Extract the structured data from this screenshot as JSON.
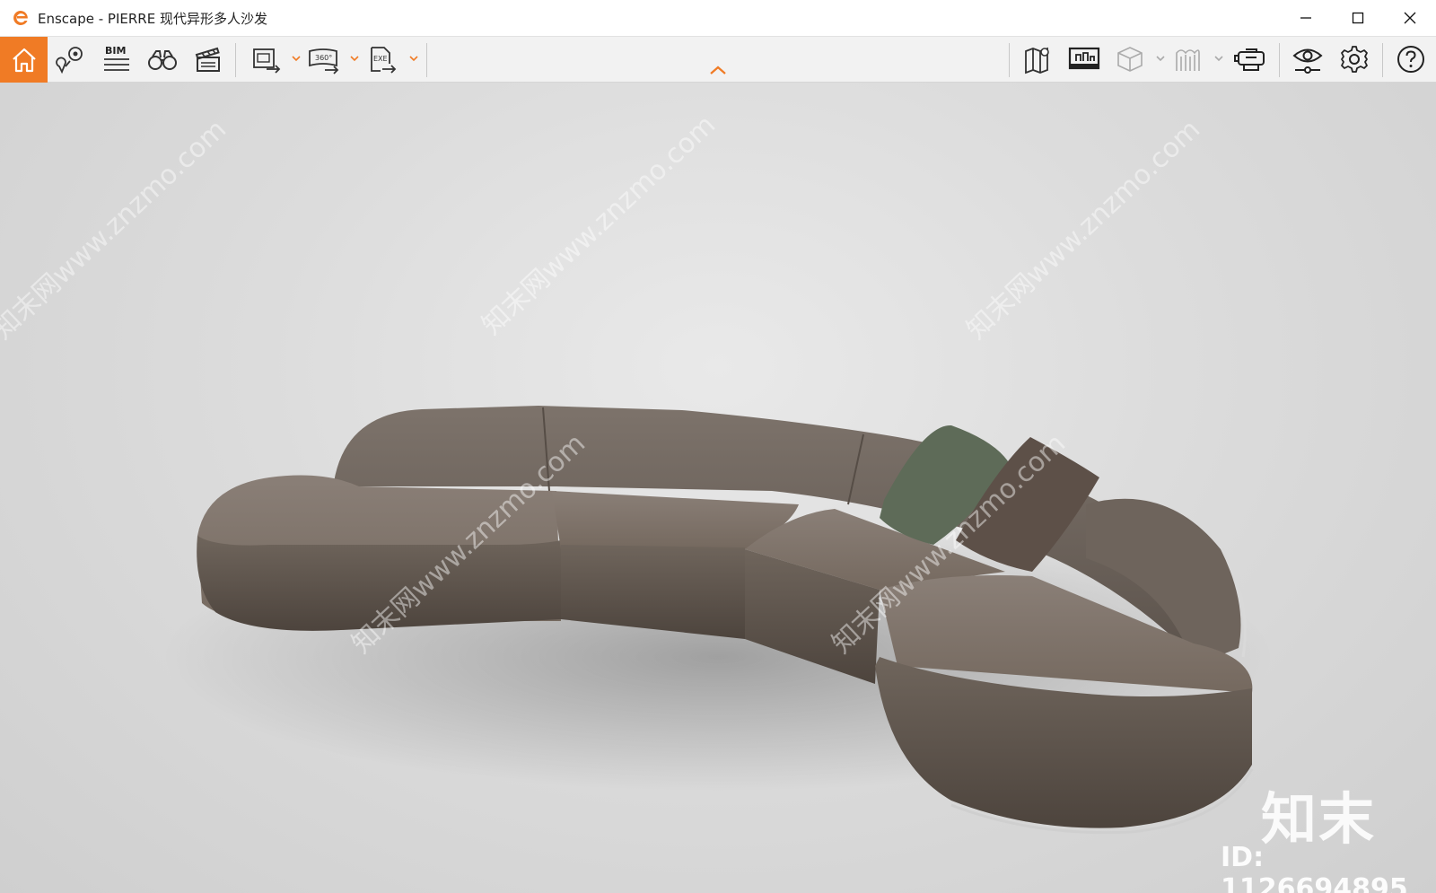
{
  "window": {
    "title": "Enscape - PIERRE 现代异形多人沙发",
    "app_icon": "enscape-logo-icon",
    "controls": [
      "minimize-icon",
      "maximize-icon",
      "close-icon"
    ]
  },
  "toolbar": {
    "accent": "#f07b25",
    "left_buttons": [
      {
        "name": "home-button",
        "icon": "home-icon"
      },
      {
        "name": "views-button",
        "icon": "location-pin-icon"
      },
      {
        "name": "bim-button",
        "icon": "bim-icon",
        "label": "BIM"
      },
      {
        "name": "binoculars-button",
        "icon": "binoculars-icon"
      },
      {
        "name": "video-editor-button",
        "icon": "clapperboard-icon"
      }
    ],
    "export_buttons": [
      {
        "name": "screenshot-export-button",
        "icon": "image-export-icon"
      },
      {
        "name": "panorama-export-button",
        "icon": "panorama-360-icon",
        "label": "360°"
      },
      {
        "name": "exe-export-button",
        "icon": "exe-export-icon",
        "label": "EXE"
      }
    ],
    "right_buttons": [
      {
        "name": "map-button",
        "icon": "map-icon"
      },
      {
        "name": "asset-library-button",
        "icon": "asset-library-icon"
      },
      {
        "name": "cube-button",
        "icon": "cube-icon"
      },
      {
        "name": "material-button",
        "icon": "material-icon"
      },
      {
        "name": "vr-headset-button",
        "icon": "vr-headset-icon"
      },
      {
        "name": "visual-settings-button",
        "icon": "eye-icon"
      },
      {
        "name": "settings-button",
        "icon": "gear-icon"
      },
      {
        "name": "help-button",
        "icon": "help-icon"
      }
    ],
    "collapse_icon": "chevron-up-icon"
  },
  "viewport": {
    "subject": "curved modular sofa with two cushions",
    "watermark_brand": "知末",
    "watermark_id": "ID: 1126694895",
    "diagonal_watermark": "知末网www.znzmo.com"
  }
}
